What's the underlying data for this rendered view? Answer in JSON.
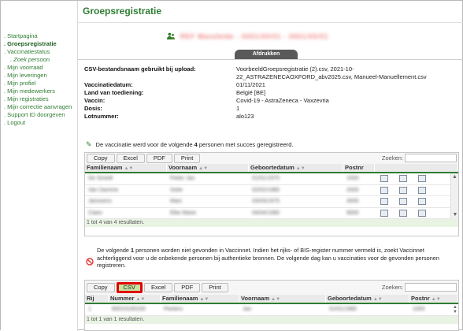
{
  "page_title": "Groepsregistratie",
  "sidebar": {
    "items": [
      {
        "label": "Startpagina"
      },
      {
        "label": "Groepsregistratie"
      },
      {
        "label": "Vaccinatiestatus"
      },
      {
        "label": "Zoek persoon"
      },
      {
        "label": "Mijn voorraad"
      },
      {
        "label": "Mijn leveringen"
      },
      {
        "label": "Mijn profiel"
      },
      {
        "label": "Mijn medewerkers"
      },
      {
        "label": "Mijn registraties"
      },
      {
        "label": "Mijn correctie aanvragen"
      },
      {
        "label": "Support ID doorgeven"
      },
      {
        "label": "Logout"
      }
    ]
  },
  "user": {
    "blurred_name": "REF Mansfelde - 0001/00/01 - 0001/00/01"
  },
  "print_button": "Afdrukken",
  "info": [
    {
      "label": "CSV-bestandsnaam gebruikt bij upload:",
      "value_line1": "VoorbeeldGroepsregistratie (2).csv, 2021-10-",
      "value_line2": "22_ASTRAZENECAOXFORD_abv2025.csv, Manueel-Manuellement.csv"
    },
    {
      "label": "Vaccinatiedatum:",
      "value": "01/11/2021"
    },
    {
      "label": "Land van toediening:",
      "value": "België [BE]"
    },
    {
      "label": "Vaccin:",
      "value": "Covid-19 - AstraZeneca - Vaxzevria"
    },
    {
      "label": "Dosis:",
      "value": "1"
    },
    {
      "label": "Lotnummer:",
      "value": "alo123"
    }
  ],
  "success": {
    "prefix": "De vaccinatie werd voor de volgende ",
    "count": "4",
    "suffix": " personen met succes geregistreerd."
  },
  "table1": {
    "buttons": [
      "Copy",
      "Excel",
      "PDF",
      "Print"
    ],
    "search_label": "Zoeken:",
    "headers": [
      "Familienaam",
      "Voornaam",
      "Geboortedatum",
      "Postnr"
    ],
    "rows": [
      [
        "De Smedt",
        "Pieter Jan",
        "01/01/1970",
        "1000"
      ],
      [
        "Van Damme",
        "Sofie",
        "02/02/1980",
        "2000"
      ],
      [
        "Janssens",
        "Marc",
        "03/03/1975",
        "3000"
      ],
      [
        "Claes",
        "Elke Marie",
        "04/04/1990",
        "9000"
      ]
    ],
    "footer": "1 tot 4 van 4 resultaten."
  },
  "warning": {
    "prefix": "De volgende ",
    "count": "1",
    "text": " personen worden niet gevonden in Vaccinnet. Indien het rijks- of BIS-register nummer vermeld is, zoekt Vaccinnet achterliggend voor u de onbekende personen bij authentieke bronnen. De volgende dag kan u vaccinaties voor de gevonden personen registreren."
  },
  "table2": {
    "buttons": [
      "Copy",
      "CSV",
      "Excel",
      "PDF",
      "Print"
    ],
    "search_label": "Zoeken:",
    "headers": [
      "Rij",
      "Nummer",
      "Familienaam",
      "Voornaam",
      "Geboortedatum",
      "Postnr"
    ],
    "rows": [
      [
        "1",
        "80010100100",
        "Peeters",
        "Jan",
        "01/01/1980",
        "1000"
      ]
    ],
    "footer": "1 tot 1 van 1 resultaten."
  },
  "colors": {
    "accent": "#2e7d32",
    "highlight": "#e00000"
  }
}
